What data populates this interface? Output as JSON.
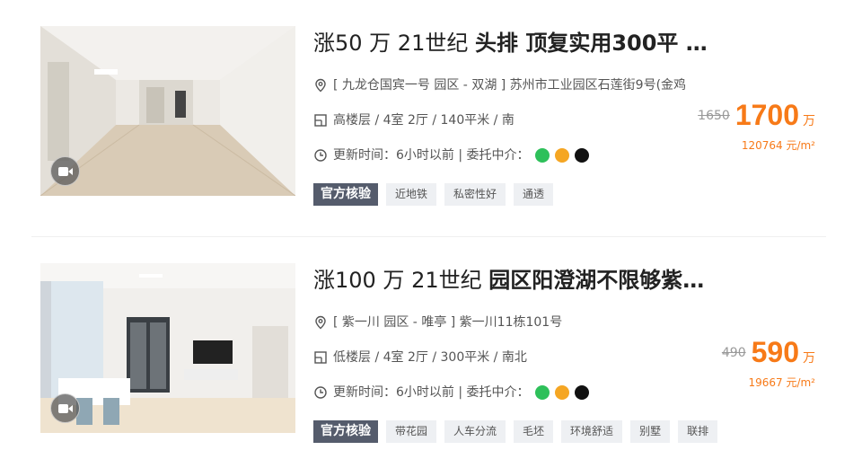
{
  "listings": [
    {
      "title_prefix": "涨50 万 21世纪",
      "title_main": "头排 顶复实用300平 …",
      "location": "[ 九龙仓国宾一号 园区 - 双湖 ] 苏州市工业园区石莲街9号(金鸡",
      "layout": "高楼层 / 4室 2厅 / 140平米 / 南",
      "update": "更新时间：6小时以前 | 委托中介：",
      "old_price": "1650",
      "price": "1700",
      "unit": "万",
      "unit_price": "120764 元/m²",
      "tags": [
        "官方核验",
        "近地铁",
        "私密性好",
        "通透"
      ]
    },
    {
      "title_prefix": "涨100 万 21世纪",
      "title_main": "园区阳澄湖不限够紫…",
      "location": "[ 紫一川 园区 - 唯亭 ] 紫一川11栋101号",
      "layout": "低楼层 / 4室 2厅 / 300平米 / 南北",
      "update": "更新时间：6小时以前 | 委托中介：",
      "old_price": "490",
      "price": "590",
      "unit": "万",
      "unit_price": "19667 元/m²",
      "tags": [
        "官方核验",
        "带花园",
        "人车分流",
        "毛坯",
        "环境舒适",
        "别墅",
        "联排"
      ]
    }
  ],
  "agency_colors": [
    "#2ec05a",
    "#f5a623",
    "#111111"
  ],
  "accent_color": "#f77a18"
}
